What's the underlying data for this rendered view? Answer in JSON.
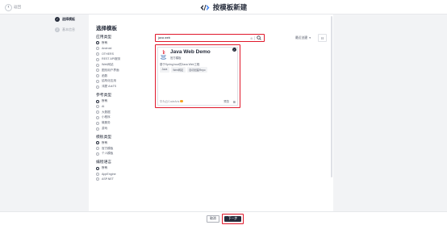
{
  "header": {
    "back_label": "返回",
    "title": "按模板新建"
  },
  "steps": [
    {
      "label": "选择模板",
      "state": "active"
    },
    {
      "label": "基本信息",
      "state": "inactive"
    }
  ],
  "panel": {
    "title": "选择模板"
  },
  "filters": {
    "app_type": {
      "title": "应用类型",
      "options": [
        "所有",
        "Android",
        "OTHERS",
        "REST API服务",
        "Web网站",
        "图形用户界面",
        "函数",
        "结构化应用",
        "鸿蒙 ArkTS"
      ]
    },
    "industry": {
      "title": "参考类型",
      "options": [
        "所有",
        "AI",
        "大数据",
        "小程序",
        "微服务",
        "游戏"
      ]
    },
    "template_type": {
      "title": "模板类型",
      "options": [
        "所有",
        "官方模板",
        "个人模板"
      ]
    },
    "tech_stack": {
      "title": "编程语言",
      "options": [
        "所有",
        "AppEngine",
        "ASP.NET"
      ]
    }
  },
  "search": {
    "value": "java web",
    "clear_glyph": "⊗"
  },
  "toolbar": {
    "sort_label": "最近创建",
    "view_glyph": "☷"
  },
  "card": {
    "name": "Java Web Demo",
    "official": "官方模板",
    "description": "基于Spring boot的Java Web工程",
    "tags": [
      "Java",
      "Web网站",
      "自动创建Repo"
    ],
    "author": "华为云CodeArts",
    "preview": "预览",
    "check_glyph": "✓",
    "delete_glyph": "⊞"
  },
  "footer": {
    "cancel_label": "取消",
    "next_label": "下一步"
  },
  "colors": {
    "accent": "#252b3a",
    "highlight": "#e0182b",
    "bg": "#f2f3f5"
  }
}
